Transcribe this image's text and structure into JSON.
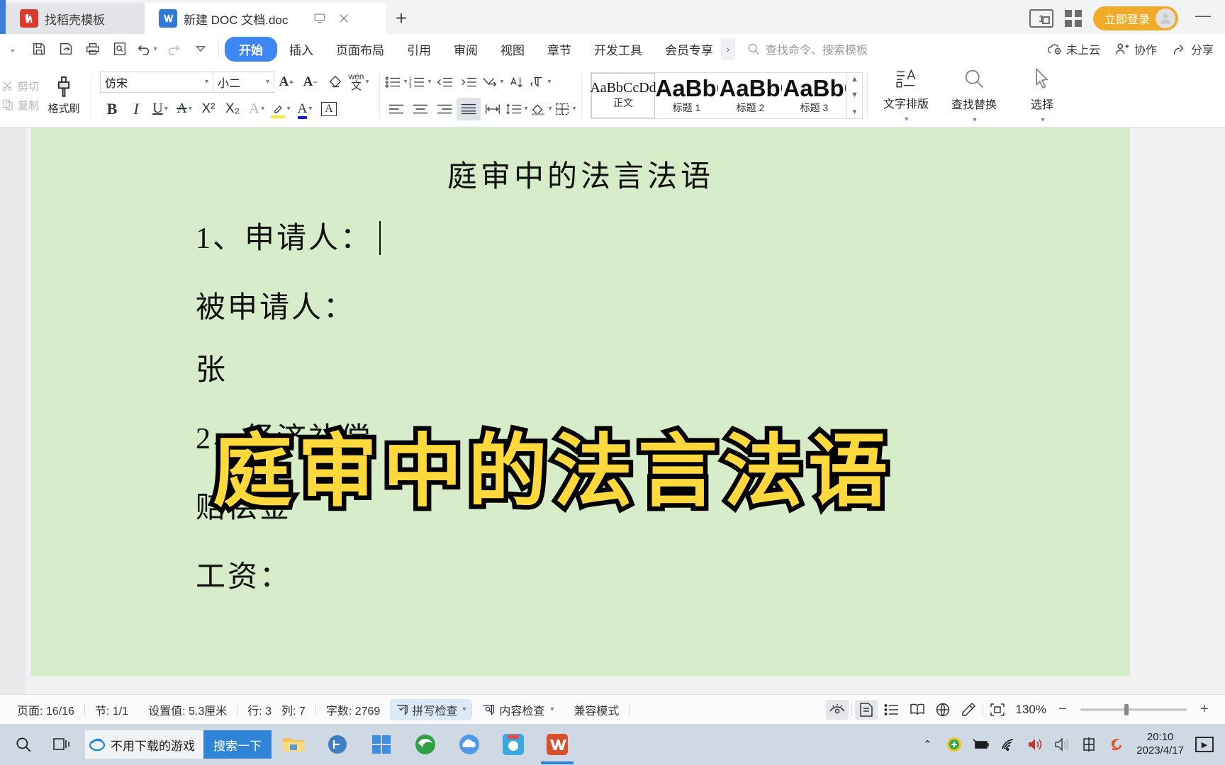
{
  "titlebar": {
    "tabs": [
      {
        "icon": "wps-docer-icon",
        "label": "找稻壳模板",
        "active": false
      },
      {
        "icon": "wps-writer-icon",
        "label": "新建 DOC 文档.doc",
        "active": true
      }
    ],
    "new_tab_label": "+",
    "screen_count": "1",
    "login_label": "立即登录",
    "minimize_label": "—"
  },
  "ribbon": {
    "quick_access": [
      "save-icon",
      "save-as-icon",
      "print-icon",
      "print-preview-icon",
      "undo-icon",
      "redo-icon",
      "customize-icon"
    ],
    "tabs": [
      {
        "label": "开始",
        "active": true
      },
      {
        "label": "插入",
        "active": false
      },
      {
        "label": "页面布局",
        "active": false
      },
      {
        "label": "引用",
        "active": false
      },
      {
        "label": "审阅",
        "active": false
      },
      {
        "label": "视图",
        "active": false
      },
      {
        "label": "章节",
        "active": false
      },
      {
        "label": "开发工具",
        "active": false
      },
      {
        "label": "会员专享",
        "active": false
      }
    ],
    "more_arrow": "›",
    "search_placeholder": "查找命令、搜索模板",
    "right_items": [
      {
        "icon": "cloud-off-icon",
        "label": "未上云"
      },
      {
        "icon": "collaborate-icon",
        "label": "协作"
      },
      {
        "icon": "share-icon",
        "label": "分享"
      }
    ]
  },
  "format_toolbar": {
    "clipboard": {
      "cut": "剪切",
      "copy": "复制",
      "painter": "格式刷"
    },
    "font": {
      "name": "仿宋",
      "size": "小二",
      "grow_label": "A+",
      "shrink_label": "A-",
      "bold": "B",
      "italic": "I",
      "underline": "U",
      "strike": "A",
      "superscript": "X²",
      "subscript": "X₂",
      "text_effect": "A",
      "highlight": "A",
      "font_color": "A",
      "pinyin": "wén",
      "border_char": "A"
    },
    "styles": [
      {
        "preview": "AaBbCcDd",
        "name": "正文",
        "selected": true
      },
      {
        "preview": "AaBbC",
        "name": "标题 1",
        "selected": false
      },
      {
        "preview": "AaBbC",
        "name": "标题 2",
        "selected": false
      },
      {
        "preview": "AaBbCc",
        "name": "标题 3",
        "selected": false
      }
    ],
    "right_buttons": [
      {
        "icon": "text-typeset-icon",
        "label": "文字排版"
      },
      {
        "icon": "find-replace-icon",
        "label": "查找替换"
      },
      {
        "icon": "select-icon",
        "label": "选择"
      }
    ]
  },
  "document": {
    "page_color": "#d7ecc8",
    "title": "庭审中的法言法语",
    "lines": [
      {
        "text": "1、申请人：",
        "caret": true
      },
      {
        "text": "被申请人：",
        "caret": false
      },
      {
        "text": "张",
        "caret": false
      },
      {
        "text": "2、经济补偿",
        "caret": false
      },
      {
        "text": "赔偿金",
        "caret": false
      },
      {
        "text": "工资：",
        "caret": false
      }
    ],
    "overlay_text": "庭审中的法言法语",
    "overlay_fill": "#ffd83b",
    "overlay_stroke": "#000000"
  },
  "statusbar": {
    "page": "页面: 16/16",
    "section": "节: 1/1",
    "setting": "设置值: 5.3厘米",
    "row": "行: 3",
    "col": "列: 7",
    "word_count": "字数: 2769",
    "spellcheck": "拼写检查",
    "contentcheck": "内容检查",
    "compat_mode": "兼容模式",
    "view_icons": [
      "eye-icon",
      "page-view-icon",
      "outline-view-icon",
      "read-view-icon",
      "web-view-icon",
      "edit-pen-icon",
      "fit-page-icon"
    ],
    "zoom": "130%",
    "zoom_out": "−",
    "zoom_in": "+"
  },
  "taskbar": {
    "start_icon": "search-icon",
    "taskview_icon": "task-view-icon",
    "search": {
      "engine_icon": "ie-icon",
      "value": "不用下载的游戏",
      "button": "搜索一下"
    },
    "apps": [
      "file-explorer-icon",
      "loop-icon",
      "store-icon",
      "edge-icon",
      "onedrive-icon",
      "live-icon",
      "wps-icon"
    ],
    "tray": {
      "chevron": "⌃",
      "icons": [
        "shield-icon",
        "battery-icon",
        "wifi-icon",
        "volume-icon",
        "volume2-icon",
        "ime-icon",
        "sogou-icon"
      ],
      "time": "20:10",
      "date": "2023/4/17",
      "show_desktop": "▶"
    }
  }
}
